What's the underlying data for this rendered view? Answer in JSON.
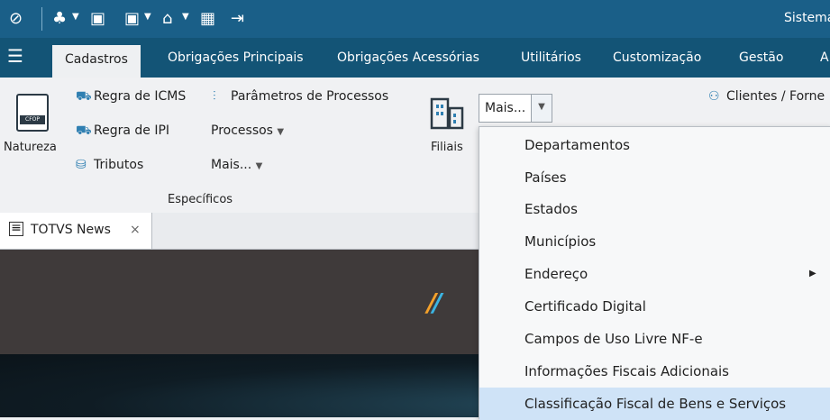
{
  "app": {
    "title": "Sistema"
  },
  "tabs": [
    "Cadastros",
    "Obrigações Principais",
    "Obrigações Acessórias",
    "Utilitários",
    "Customização",
    "Gestão",
    "A"
  ],
  "ribbon": {
    "natureza": "Natureza",
    "natureza_tag": "CFOP",
    "regra_icms": "Regra de ICMS",
    "regra_ipi": "Regra de IPI",
    "tributos": "Tributos",
    "parametros": "Parâmetros de Processos",
    "processos": "Processos",
    "mais1": "Mais...",
    "group_especificos": "Específicos",
    "filiais": "Filiais",
    "mais_combo": "Mais...",
    "clientes": "Clientes / Forne"
  },
  "doc_tab": {
    "label": "TOTVS News",
    "close": "×"
  },
  "dropdown": {
    "items": [
      "Departamentos",
      "Países",
      "Estados",
      "Municípios",
      "Endereço",
      "Certificado Digital",
      "Campos de Uso Livre NF-e",
      "Informações Fiscais Adicionais",
      "Classificação Fiscal de Bens e Serviços"
    ],
    "highlighted_index": 8
  },
  "colors": {
    "titlebar": "#1a5f88",
    "tabbar": "#135476",
    "accent": "#2f7fb1",
    "highlight": "#cfe3f7"
  }
}
